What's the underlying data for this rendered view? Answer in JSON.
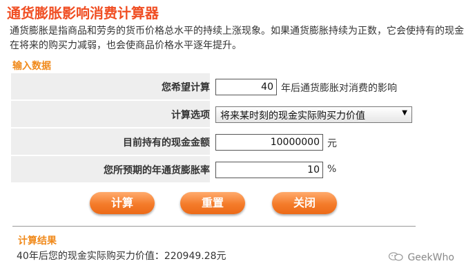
{
  "header": {
    "title": "通货膨胀影响消费计算器",
    "description": "通货膨胀是指商品和劳务的货币价格总水平的持续上涨现象。如果通货膨胀持续为正数，它会使持有的现金在将来的购买力减弱，也会使商品价格水平逐年提升。"
  },
  "input_section": {
    "heading": "输入数据",
    "rows": [
      {
        "label": "您希望计算",
        "value": "40",
        "suffix": "年后通货膨胀对消费的影响"
      },
      {
        "label": "计算选项",
        "selected": "将来某时刻的现金实际购买力价值"
      },
      {
        "label": "目前持有的现金金额",
        "value": "10000000",
        "suffix": "元"
      },
      {
        "label": "您所预期的年通货膨胀率",
        "value": "10",
        "suffix": "%"
      }
    ]
  },
  "buttons": {
    "calculate": "计算",
    "reset": "重置",
    "close": "关闭"
  },
  "result_section": {
    "heading": "计算结果",
    "text": "40年后您的现金实际购买力价值：220949.28元"
  },
  "watermark": {
    "text": "GeekWho",
    "icon": "wechat-icon"
  },
  "colors": {
    "title": "#f04e23",
    "section_heading": "#f08a1c",
    "button": "#f47b2a",
    "label_bg": "#eeeeee"
  }
}
